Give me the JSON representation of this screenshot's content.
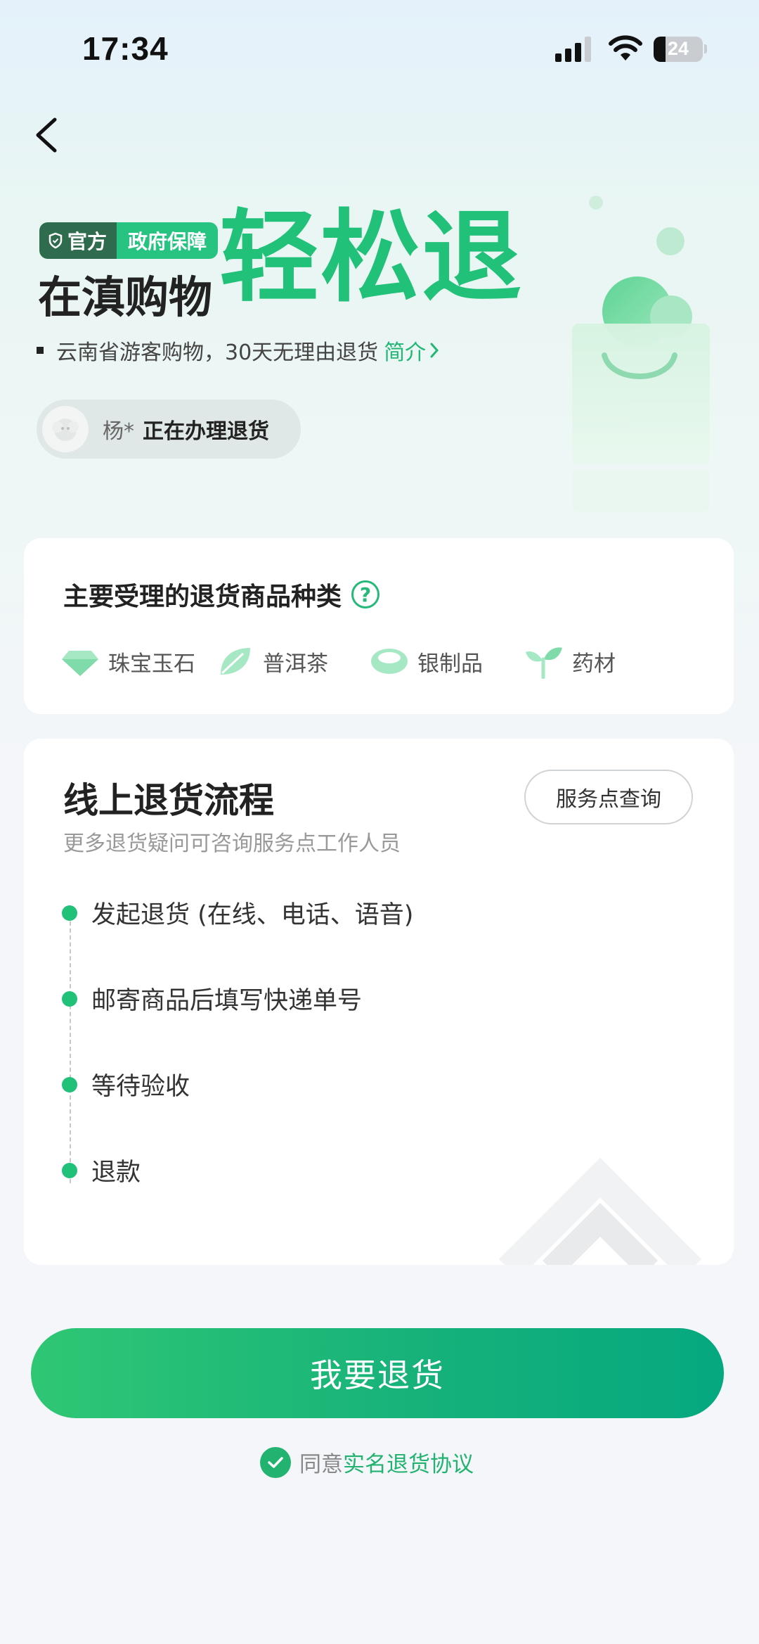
{
  "status_bar": {
    "time": "17:34",
    "battery": "24",
    "icons": [
      "signal-icon",
      "wifi-icon",
      "battery-icon"
    ]
  },
  "nav": {
    "back_icon": "chevron-left-icon"
  },
  "hero": {
    "badge_official": "官方",
    "badge_gov": "政府保障",
    "title_prefix": "在滇购物",
    "title_main": "轻松退",
    "subtitle": "云南省游客购物，30天无理由退货",
    "intro_link": "简介",
    "notify_name": "杨*",
    "notify_status": "正在办理退货"
  },
  "categories_card": {
    "title": "主要受理的退货商品种类",
    "help_icon": "question-circle-icon",
    "items": [
      {
        "label": "珠宝玉石",
        "icon": "gem-icon"
      },
      {
        "label": "普洱茶",
        "icon": "tea-leaf-icon"
      },
      {
        "label": "银制品",
        "icon": "silver-bracelet-icon"
      },
      {
        "label": "药材",
        "icon": "herb-sprout-icon"
      }
    ]
  },
  "process_card": {
    "title": "线上退货流程",
    "subtitle": "更多退货疑问可咨询服务点工作人员",
    "service_button": "服务点查询",
    "steps": [
      "发起退货 (在线、电话、语音)",
      "邮寄商品后填写快递单号",
      "等待验收",
      "退款"
    ]
  },
  "cta": {
    "label": "我要退货"
  },
  "agreement": {
    "prefix": "同意",
    "link": "实名退货协议"
  },
  "colors": {
    "brand_green": "#22c17a",
    "badge_dark": "#2f6b4d",
    "link_green": "#22b370"
  }
}
